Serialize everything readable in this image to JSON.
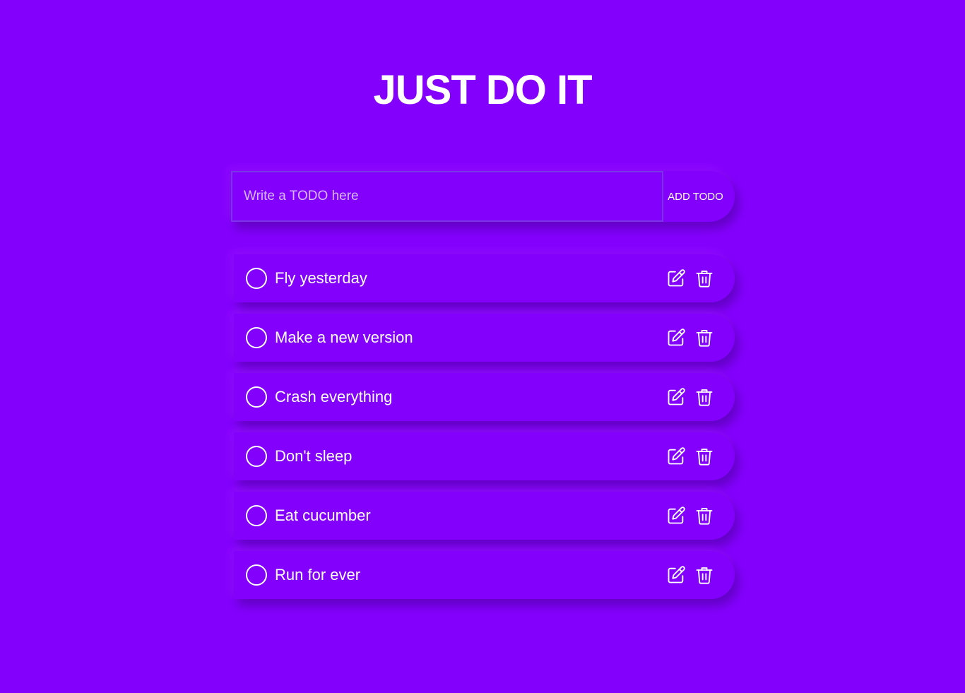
{
  "header": {
    "title": "JUST DO IT"
  },
  "form": {
    "placeholder": "Write a TODO here",
    "value": "",
    "add_label": "ADD TODO"
  },
  "todos": [
    {
      "text": "Fly yesterday",
      "done": false
    },
    {
      "text": "Make a new version",
      "done": false
    },
    {
      "text": "Crash everything",
      "done": false
    },
    {
      "text": "Don't sleep",
      "done": false
    },
    {
      "text": "Eat cucumber",
      "done": false
    },
    {
      "text": "Run for ever",
      "done": false
    }
  ],
  "icons": {
    "check": "circle-checkbox-icon",
    "edit": "edit-icon",
    "delete": "trash-icon"
  },
  "colors": {
    "background": "#8400fd",
    "text": "#ffffff",
    "input_border": "#7a36e6",
    "placeholder": "#d6b8ff"
  }
}
